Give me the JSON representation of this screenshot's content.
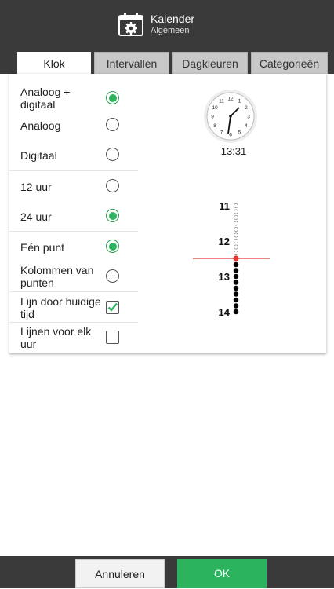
{
  "header": {
    "title": "Kalender",
    "subtitle": "Algemeen",
    "icon": "calendar-gear-icon"
  },
  "tabs": [
    {
      "label": "Klok",
      "active": true
    },
    {
      "label": "Intervallen",
      "active": false
    },
    {
      "label": "Dagkleuren",
      "active": false
    },
    {
      "label": "Categorieën",
      "active": false
    }
  ],
  "options": [
    {
      "label": "Analoog + digitaal",
      "control": "radio",
      "checked": true
    },
    {
      "label": "Analoog",
      "control": "radio",
      "checked": false
    },
    {
      "label": "Digitaal",
      "control": "radio",
      "checked": false
    },
    {
      "label": "12 uur",
      "control": "radio",
      "checked": false
    },
    {
      "label": "24 uur",
      "control": "radio",
      "checked": true
    },
    {
      "label": "Eén punt",
      "control": "radio",
      "checked": true
    },
    {
      "label": "Kolommen van punten",
      "control": "radio",
      "checked": false
    },
    {
      "label": "Lijn door huidige tijd",
      "control": "checkbox",
      "checked": true
    },
    {
      "label": "Lijnen voor elk uur",
      "control": "checkbox",
      "checked": false
    }
  ],
  "preview": {
    "clock_time": "13:31",
    "clock_numbers": [
      "12",
      "1",
      "2",
      "3",
      "4",
      "5",
      "6",
      "7",
      "8",
      "9",
      "10",
      "11"
    ],
    "timeline_hours": [
      "11",
      "12",
      "13",
      "14"
    ]
  },
  "footer": {
    "cancel_label": "Annuleren",
    "ok_label": "OK"
  },
  "colors": {
    "accent": "#2bb35d",
    "header": "#3a3a3a",
    "current_time_line": "#e53935"
  }
}
